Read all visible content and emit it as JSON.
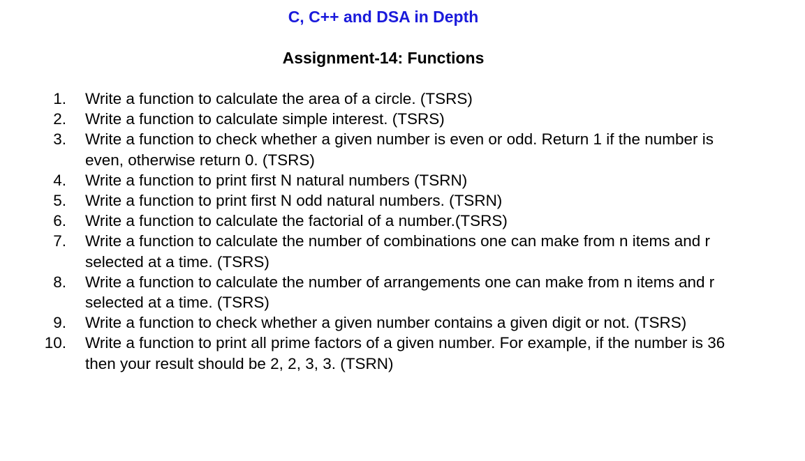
{
  "header": {
    "course_title": "C, C++ and DSA in Depth",
    "assignment_title": "Assignment-14: Functions"
  },
  "colors": {
    "course_title": "#1a1adb",
    "body_text": "#000000",
    "background": "#ffffff"
  },
  "tasks": [
    {
      "number": "1.",
      "text": "Write a function to calculate the area of a circle. (TSRS)"
    },
    {
      "number": "2.",
      "text": "Write a function to calculate simple interest. (TSRS)"
    },
    {
      "number": "3.",
      "text": "Write a function to check whether a given number is even or odd. Return 1 if the number is even, otherwise return 0. (TSRS)"
    },
    {
      "number": "4.",
      "text": "Write a function to print first N natural numbers (TSRN)"
    },
    {
      "number": "5.",
      "text": "Write a function to print first N odd natural numbers. (TSRN)"
    },
    {
      "number": "6.",
      "text": "Write a function to calculate the factorial of a number.(TSRS)"
    },
    {
      "number": "7.",
      "text": "Write a function to calculate the number of combinations one can make from n items and r selected at a time. (TSRS)"
    },
    {
      "number": "8.",
      "text": "Write a function to calculate the number of arrangements one can make from n items and r selected at a time. (TSRS)"
    },
    {
      "number": "9.",
      "text": "Write a function to check whether a given number contains a given digit or not. (TSRS)"
    },
    {
      "number": "10.",
      "text": "Write a function to print all prime factors of a given number. For example, if the number is 36 then your result should be 2, 2, 3, 3. (TSRN)"
    }
  ]
}
